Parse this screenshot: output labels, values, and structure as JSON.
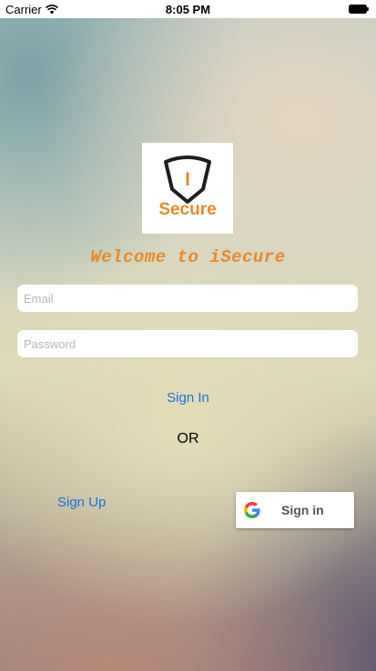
{
  "status_bar": {
    "carrier": "Carrier",
    "time": "8:05 PM",
    "wifi_icon": "wifi-icon",
    "battery_icon": "battery-icon"
  },
  "logo": {
    "letter": "I",
    "text": "Secure",
    "icon": "shield-icon",
    "color": "#e8892a"
  },
  "welcome_text": "Welcome to iSecure",
  "form": {
    "email_placeholder": "Email",
    "email_value": "",
    "password_placeholder": "Password",
    "password_value": ""
  },
  "signin_label": "Sign In",
  "or_label": "OR",
  "signup_label": "Sign Up",
  "google_button": {
    "label": "Sign in",
    "icon": "google-icon"
  },
  "colors": {
    "accent": "#e8892a",
    "link": "#1a73e0"
  }
}
